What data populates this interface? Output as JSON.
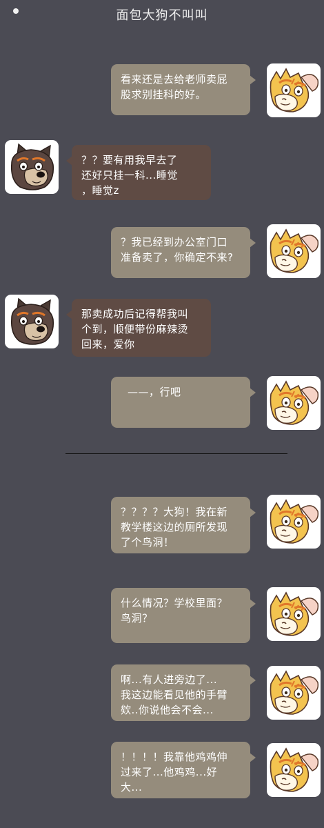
{
  "header": {
    "title": "面包大狗不叫叫"
  },
  "messages": [
    {
      "side": "me",
      "text": "看来还是去给老师卖屁\n股求别挂科的好。"
    },
    {
      "side": "other",
      "text": "？？要有用我早去了\n还好只挂一科...睡觉\n，睡觉z"
    },
    {
      "side": "me",
      "text": "？我已经到办公室门口\n准备卖了，你确定不来?"
    },
    {
      "side": "other",
      "text": "那卖成功后记得帮我叫\n个到，顺便带份麻辣烫\n回来，爱你"
    },
    {
      "side": "me",
      "text": "——，行吧"
    },
    {
      "side": "me",
      "text": "？？？？大狗！我在新\n教学楼这边的厕所发现\n了个鸟洞！"
    },
    {
      "side": "me",
      "text": "什么情况？学校里面？\n鸟洞？"
    },
    {
      "side": "me",
      "text": "啊...有人进旁边了...\n我这边能看见他的手臂\n欸..你说他会不会..."
    },
    {
      "side": "me",
      "text": "！！！！我靠他鸡鸡伸\n过来了...他鸡鸡...好\n大..."
    }
  ],
  "colors": {
    "background": "#4b4b54",
    "my_bubble": "#958c7c",
    "other_bubble": "#5f4b44"
  },
  "icons": {
    "my_avatar": "yellow-cat-avatar-icon",
    "other_avatar": "brown-dog-avatar-icon"
  }
}
